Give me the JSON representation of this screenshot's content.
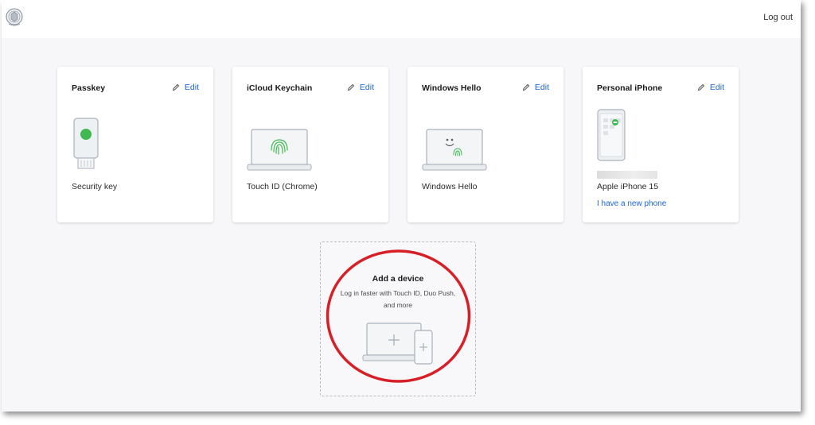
{
  "header": {
    "logout_label": "Log out",
    "logo_icon": "university-seal-icon"
  },
  "devices": [
    {
      "title": "Passkey",
      "edit_label": "Edit",
      "label": "Security key",
      "icon": "security-key-icon"
    },
    {
      "title": "iCloud Keychain",
      "edit_label": "Edit",
      "label": "Touch ID (Chrome)",
      "icon": "laptop-fingerprint-icon"
    },
    {
      "title": "Windows Hello",
      "edit_label": "Edit",
      "label": "Windows Hello",
      "icon": "laptop-face-icon"
    },
    {
      "title": "Personal iPhone",
      "edit_label": "Edit",
      "label": "Apple iPhone 15",
      "link": "I have a new phone",
      "icon": "phone-duo-icon"
    }
  ],
  "add_device": {
    "title": "Add a device",
    "description": "Log in faster with Touch ID, Duo Push, and more",
    "icon": "add-device-icon"
  },
  "colors": {
    "link": "#1a66d6",
    "accent_green": "#3fb950",
    "highlight_red": "#d61f26",
    "illustration_stroke": "#a9b0ba"
  }
}
